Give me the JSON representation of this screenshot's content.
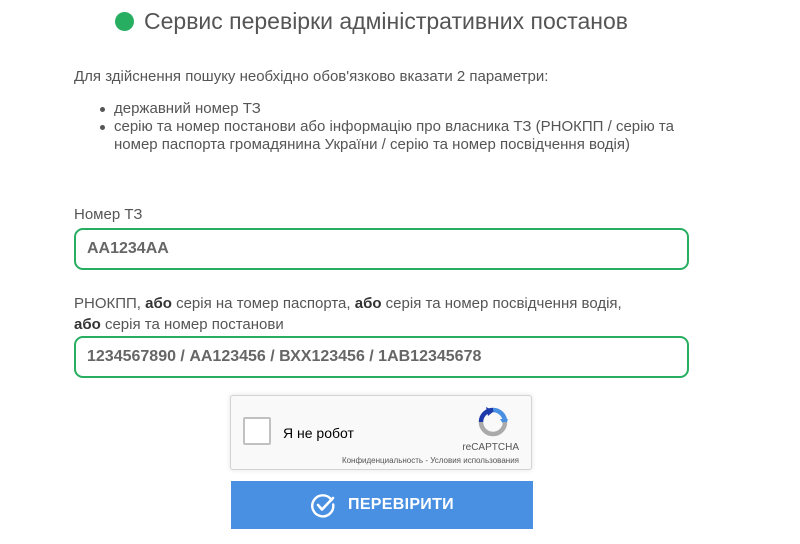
{
  "header": {
    "title": "Сервис перевірки адміністративних постанов",
    "status_color": "#27ae60"
  },
  "intro": {
    "text": "Для здійснення пошуку необхідно обов'язково вказати 2 параметри:",
    "requirements": [
      "державний номер ТЗ",
      "серію та номер постанови або інформацію про власника ТЗ (РНОКПП / серію та номер паспорта громадянина України / серію та номер посвідчення водія)"
    ]
  },
  "form": {
    "plate": {
      "label": "Номер ТЗ",
      "placeholder": "AA1234AA",
      "value": ""
    },
    "identity": {
      "label_parts": [
        "РНОКПП, ",
        "або",
        " серія на томер паспорта, ",
        "або",
        " серія та номер посвідчення водія, ",
        "або",
        " серія та номер постанови"
      ],
      "placeholder": "1234567890 / АА123456 / ВХХ123456 / 1АВ12345678",
      "value": ""
    },
    "recaptcha": {
      "label": "Я не робот",
      "brand": "reCAPTCHA",
      "privacy": "Конфиденциальность",
      "separator": " - ",
      "terms": "Условия использования",
      "checked": false
    },
    "submit": {
      "label": "ПЕРЕВІРИТИ",
      "icon": "check-circle-icon",
      "color": "#4a90e2"
    },
    "accent_color": "#27ae60"
  }
}
